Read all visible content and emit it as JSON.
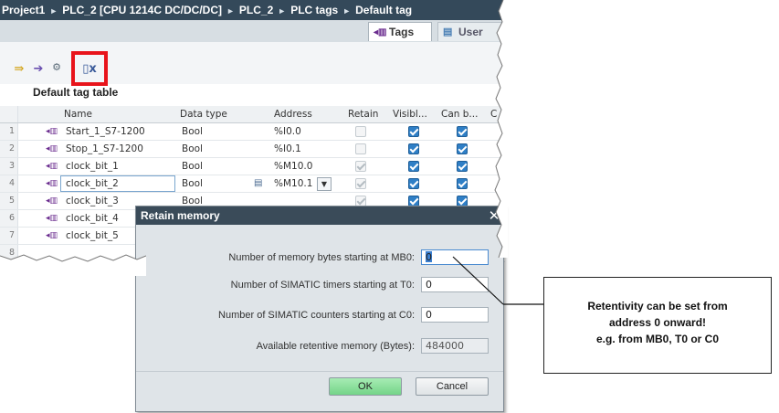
{
  "breadcrumb": {
    "items": [
      "Project1",
      "PLC_2 [CPU 1214C DC/DC/DC]",
      "PLC_2",
      "PLC tags",
      "Default tag"
    ]
  },
  "tabs": [
    {
      "label": "Tags",
      "icon": "tag-table-icon",
      "active": true
    },
    {
      "label": "User",
      "icon": "user-constants-icon",
      "active": false
    }
  ],
  "toolbar": {
    "icons": [
      "add-row-icon",
      "insert-row-icon",
      "export-icon",
      "retain-memory-icon"
    ],
    "highlight_color": "#e8141b"
  },
  "table": {
    "title": "Default tag table",
    "columns": [
      "Name",
      "Data type",
      "Address",
      "Retain",
      "Visibl...",
      "Can b...",
      "C"
    ],
    "rows": [
      {
        "num": "1",
        "name": "Start_1_S7-1200",
        "type": "Bool",
        "address": "%I0.0",
        "retain": "empty",
        "visible": true,
        "can": true
      },
      {
        "num": "2",
        "name": "Stop_1_S7-1200",
        "type": "Bool",
        "address": "%I0.1",
        "retain": "empty",
        "visible": true,
        "can": true
      },
      {
        "num": "3",
        "name": "clock_bit_1",
        "type": "Bool",
        "address": "%M10.0",
        "retain": "grey",
        "visible": true,
        "can": true
      },
      {
        "num": "4",
        "name": "clock_bit_2",
        "type": "Bool",
        "address": "%M10.1",
        "retain": "grey",
        "visible": true,
        "can": true
      },
      {
        "num": "5",
        "name": "clock_bit_3",
        "type": "Bool",
        "address": "",
        "retain": "grey",
        "visible": true,
        "can": true
      },
      {
        "num": "6",
        "name": "clock_bit_4",
        "type": "",
        "address": "",
        "retain": "",
        "visible": false,
        "can": false
      },
      {
        "num": "7",
        "name": "clock_bit_5",
        "type": "",
        "address": "",
        "retain": "",
        "visible": false,
        "can": false
      },
      {
        "num": "8",
        "name": "",
        "type": "",
        "address": "",
        "retain": "",
        "visible": false,
        "can": false
      }
    ]
  },
  "dialog": {
    "title": "Retain memory",
    "fields": [
      {
        "label": "Number of memory bytes starting at MB0:",
        "value": "0"
      },
      {
        "label": "Number of SIMATIC timers starting at T0:",
        "value": "0"
      },
      {
        "label": "Number of SIMATIC counters starting at C0:",
        "value": "0"
      },
      {
        "label": "Available retentive memory (Bytes):",
        "value": "484000"
      }
    ],
    "ok_label": "OK",
    "cancel_label": "Cancel"
  },
  "callout": {
    "line1": "Retentivity can be set from",
    "line2": "address 0 onward!",
    "line3": "e.g. from MB0, T0 or C0"
  }
}
